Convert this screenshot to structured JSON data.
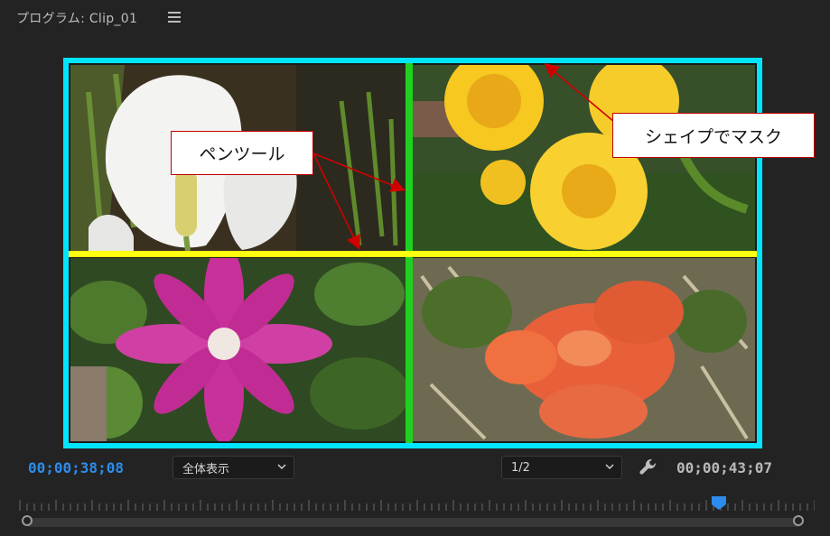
{
  "panel": {
    "title": "プログラム: Clip_01",
    "menu_icon": "hamburger-menu-icon"
  },
  "viewer": {
    "quadrants": [
      "white calla lily",
      "yellow roses",
      "pink clematis",
      "orange azaleas"
    ],
    "annotations": {
      "pen_tool": "ペンツール",
      "shape_mask": "シェイプでマスク"
    },
    "colors": {
      "outline": "#00e5ff",
      "vertical_divider": "#20d020",
      "horizontal_divider": "#ffff10",
      "callout_border": "#c00000",
      "arrow": "#d00000"
    }
  },
  "controls": {
    "current_timecode": "00;00;38;08",
    "zoom_select": "全体表示",
    "resolution_select": "1/2",
    "settings_icon": "wrench-icon",
    "duration_timecode": "00;00;43;07",
    "timecode_color": "#2d8ceb",
    "playhead_color": "#2d8ceb",
    "playhead_position": 0.88
  }
}
